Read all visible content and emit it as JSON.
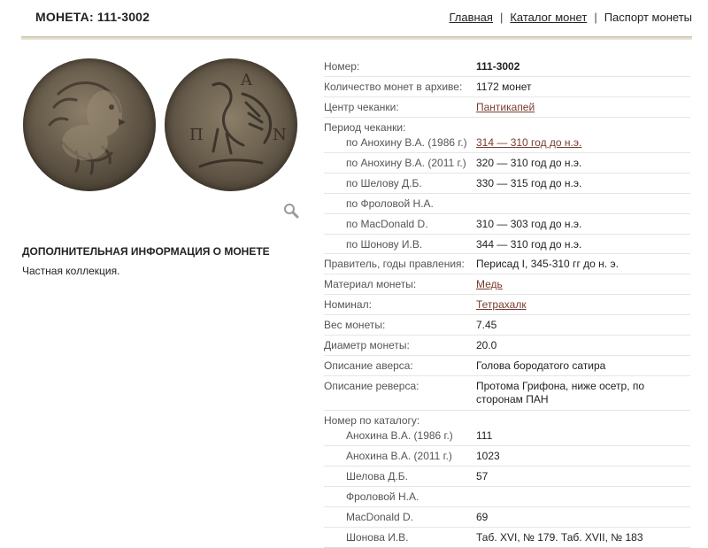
{
  "header": {
    "title": "МОНЕТА: 111-3002",
    "nav": [
      "Главная",
      "Каталог монет",
      "Паспорт монеты"
    ]
  },
  "extra": {
    "title": "ДОПОЛНИТЕЛЬНАЯ ИНФОРМАЦИЯ О МОНЕТЕ",
    "text": "Частная коллекция."
  },
  "coin_images": {
    "obverse_icon": "satyr-head-coin",
    "reverse_icon": "griffin-protome-coin",
    "zoom_icon": "magnifier-icon",
    "reverse_letters": [
      "Π",
      "Α",
      "Ν"
    ]
  },
  "rows": {
    "number": {
      "label": "Номер:",
      "value": "111-3002"
    },
    "count": {
      "label": "Количество монет в архиве:",
      "value": "1172 монет"
    },
    "mint": {
      "label": "Центр чеканки:",
      "value": "Пантикапей"
    },
    "period": {
      "label": "Период чеканки:"
    },
    "p1": {
      "label": "по Анохину В.А. (1986 г.)",
      "value": "314 — 310 год до н.э."
    },
    "p2": {
      "label": "по Анохину В.А. (2011 г.)",
      "value": "320 — 310 год до н.э."
    },
    "p3": {
      "label": "по Шелову Д.Б.",
      "value": "330 — 315 год до н.э."
    },
    "p4": {
      "label": "по Фроловой Н.А.",
      "value": ""
    },
    "p5": {
      "label": "по MacDonald D.",
      "value": "310 — 303 год до н.э."
    },
    "p6": {
      "label": "по Шонову И.В.",
      "value": "344 — 310 год до н.э."
    },
    "ruler": {
      "label": "Правитель, годы правления:",
      "value": "Перисад I, 345-310 гг до н. э."
    },
    "material": {
      "label": "Материал монеты:",
      "value": "Медь"
    },
    "nominal": {
      "label": "Номинал:",
      "value": "Тетрахалк"
    },
    "weight": {
      "label": "Вес монеты:",
      "value": "7.45"
    },
    "diameter": {
      "label": "Диаметр монеты:",
      "value": "20.0"
    },
    "obverse": {
      "label": "Описание аверса:",
      "value": "Голова бородатого сатира"
    },
    "reverse": {
      "label": "Описание реверса:",
      "value": "Протома Грифона, ниже осетр, по сторонам ПАН"
    },
    "catalog": {
      "label": "Номер по каталогу:"
    },
    "c1": {
      "label": "Анохина В.А. (1986 г.)",
      "value": "111"
    },
    "c2": {
      "label": "Анохина В.А. (2011 г.)",
      "value": "1023"
    },
    "c3": {
      "label": "Шелова Д.Б.",
      "value": "57"
    },
    "c4": {
      "label": "Фроловой Н.А.",
      "value": ""
    },
    "c5": {
      "label": "MacDonald D.",
      "value": "69"
    },
    "c6": {
      "label": "Шонова И.В.",
      "value": "Таб. XVI, № 179. Таб. XVII, № 183"
    }
  }
}
